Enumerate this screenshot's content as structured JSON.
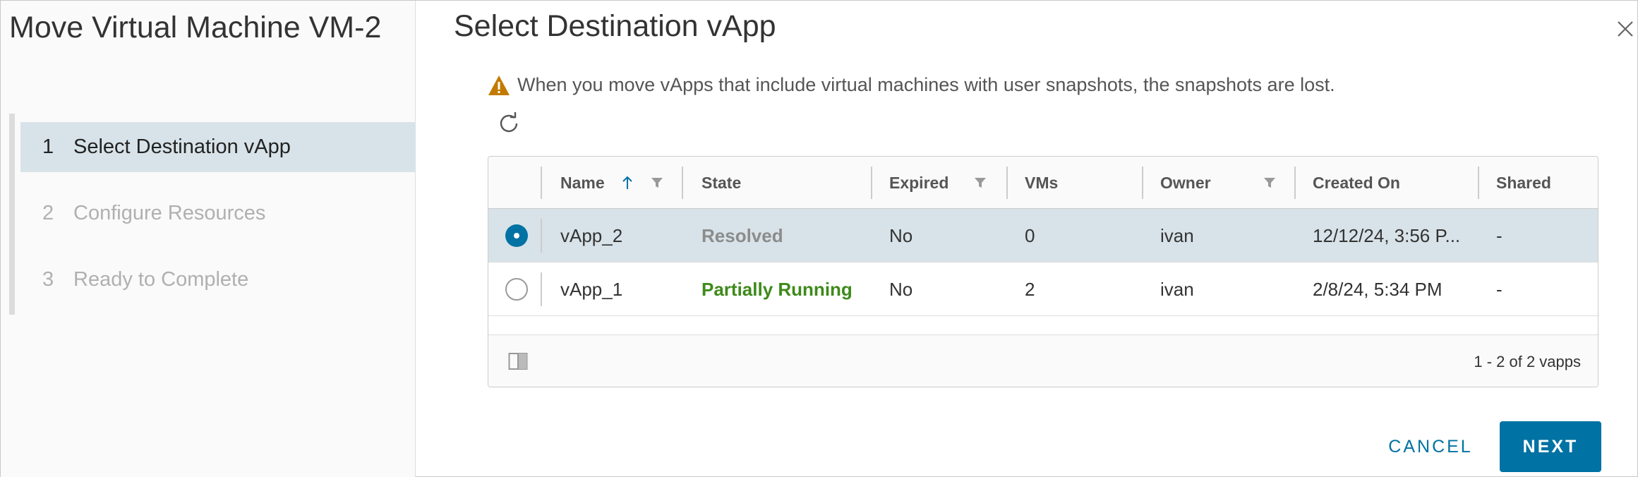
{
  "wizard": {
    "title": "Move Virtual Machine VM-2",
    "steps": [
      {
        "num": "1",
        "label": "Select Destination vApp",
        "active": true
      },
      {
        "num": "2",
        "label": "Configure Resources",
        "active": false
      },
      {
        "num": "3",
        "label": "Ready to Complete",
        "active": false
      }
    ]
  },
  "main": {
    "title": "Select Destination vApp",
    "warning": "When you move vApps that include virtual machines with user snapshots, the snapshots are lost.",
    "icons": {
      "warning": "warning-triangle-icon",
      "refresh": "refresh-icon",
      "close": "close-icon",
      "column_toggle": "column-toggle-icon",
      "filter": "filter-icon",
      "sort": "sort-ascending-icon"
    }
  },
  "grid": {
    "columns": [
      "Name",
      "State",
      "Expired",
      "VMs",
      "Owner",
      "Created On",
      "Shared"
    ],
    "rows": [
      {
        "selected": true,
        "name": "vApp_2",
        "state": "Resolved",
        "expired": "No",
        "vms": "0",
        "owner": "ivan",
        "created": "12/12/24, 3:56 P...",
        "shared": "-"
      },
      {
        "selected": false,
        "name": "vApp_1",
        "state": "Partially Running",
        "expired": "No",
        "vms": "2",
        "owner": "ivan",
        "created": "2/8/24, 5:34 PM",
        "shared": "-"
      }
    ],
    "pagination": "1 - 2 of 2 vapps"
  },
  "buttons": {
    "cancel": "CANCEL",
    "next": "NEXT"
  },
  "colors": {
    "accent": "#0072a3",
    "selected_row": "#d8e3e9",
    "running": "#3e8a1a",
    "warning": "#c27b00"
  }
}
